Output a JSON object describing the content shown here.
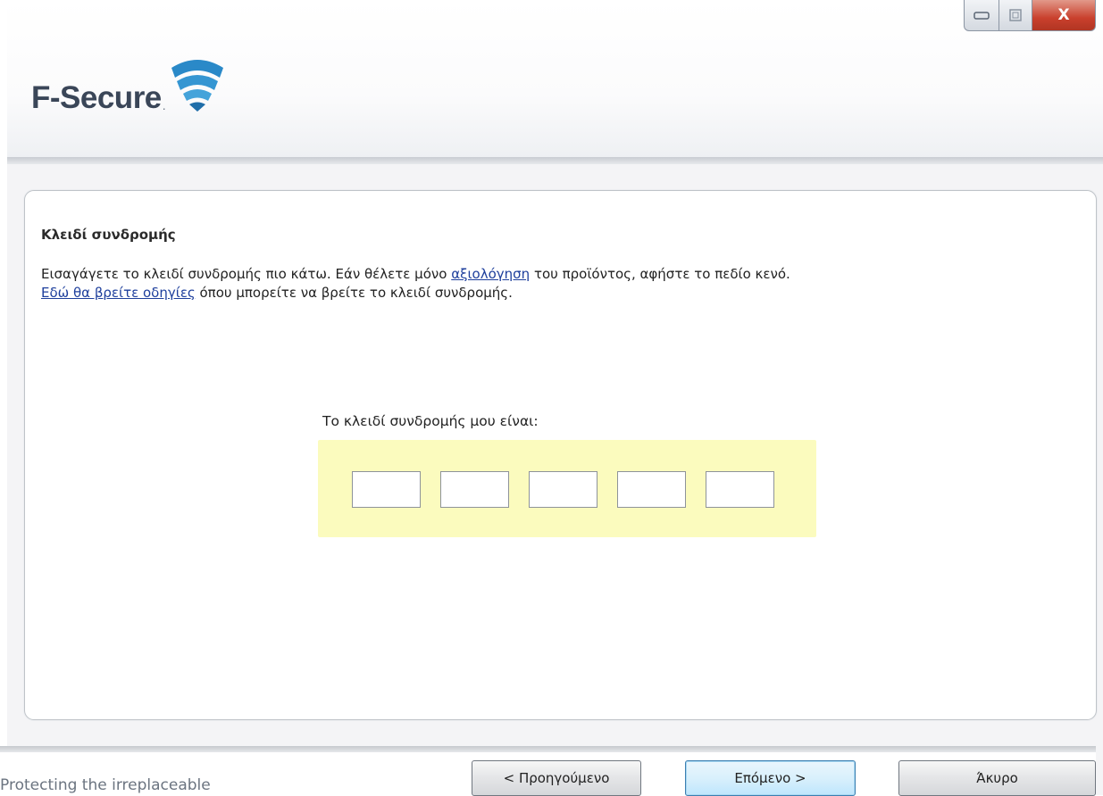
{
  "header": {
    "brand": "F-Secure",
    "brand_mark": "."
  },
  "window_controls": {
    "close_label": "X"
  },
  "panel": {
    "title": "Κλειδί συνδρομής",
    "desc_part1": "Εισαγάγετε το κλειδί συνδρομής πιο κάτω. Εάν θέλετε μόνο ",
    "desc_link1": "αξιολόγηση",
    "desc_part2": " του προϊόντος, αφήστε το πεδίο κενό.",
    "desc_link2": "Εδώ θα βρείτε οδηγίες",
    "desc_part3": " όπου μπορείτε να βρείτε το κλειδί συνδρομής."
  },
  "key_entry": {
    "label": "Το κλειδί συνδρομής μου είναι:",
    "fields": [
      "",
      "",
      "",
      "",
      ""
    ]
  },
  "footer": {
    "tagline": "Protecting the irreplaceable",
    "back_label": "< Προηγούμενο",
    "next_label": "Επόμενο >",
    "cancel_label": "Άκυρο"
  },
  "colors": {
    "brand_text": "#3a4658",
    "logo_blue": "#2a89c8",
    "key_highlight": "#fbfbbe",
    "link": "#1e3f9c",
    "close_button": "#c9402d"
  }
}
